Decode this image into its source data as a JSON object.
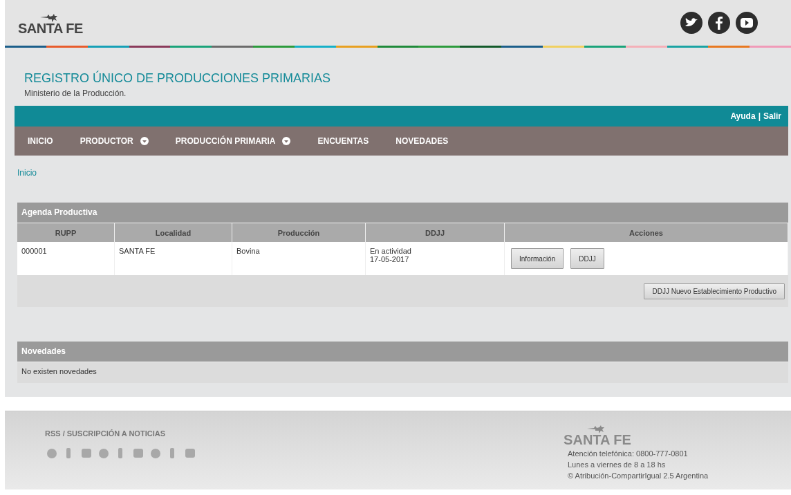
{
  "header": {
    "logo": "SANTA FE"
  },
  "title": "REGISTRO ÚNICO DE PRODUCCIONES PRIMARIAS",
  "subtitle": "Ministerio de la Producción.",
  "top_links": {
    "items": [
      "Ayuda",
      "Salir"
    ],
    "separator": "|"
  },
  "nav": [
    {
      "label": "INICIO",
      "dropdown": false
    },
    {
      "label": "PRODUCTOR",
      "dropdown": true
    },
    {
      "label": "PRODUCCIÓN PRIMARIA",
      "dropdown": true
    },
    {
      "label": "ENCUENTAS",
      "dropdown": false
    },
    {
      "label": "NOVEDADES",
      "dropdown": false
    }
  ],
  "breadcrumb": "Inicio",
  "agenda": {
    "title": "Agenda Productiva",
    "columns": [
      "RUPP",
      "Localidad",
      "Producción",
      "DDJJ",
      "Acciones"
    ],
    "rows": [
      {
        "rupp": "000001",
        "localidad": "SANTA FE",
        "produccion": "Bovina",
        "ddjj": [
          "En actividad",
          "17-05-2017"
        ],
        "actions": [
          "Información",
          "DDJJ"
        ]
      }
    ],
    "footer_button": "DDJJ Nuevo Establecimiento Productivo"
  },
  "novedades": {
    "title": "Novedades",
    "message": "No existen novedades"
  },
  "footer": {
    "rss": "RSS / SUSCRIPCIÓN A NOTICIAS",
    "logo": "SANTA FE",
    "contact": [
      "Atención telefónica: 0800-777-0801",
      "Lunes a viernes de 8 a 18 hs",
      "© Atribución-CompartirIgual 2.5 Argentina"
    ]
  }
}
